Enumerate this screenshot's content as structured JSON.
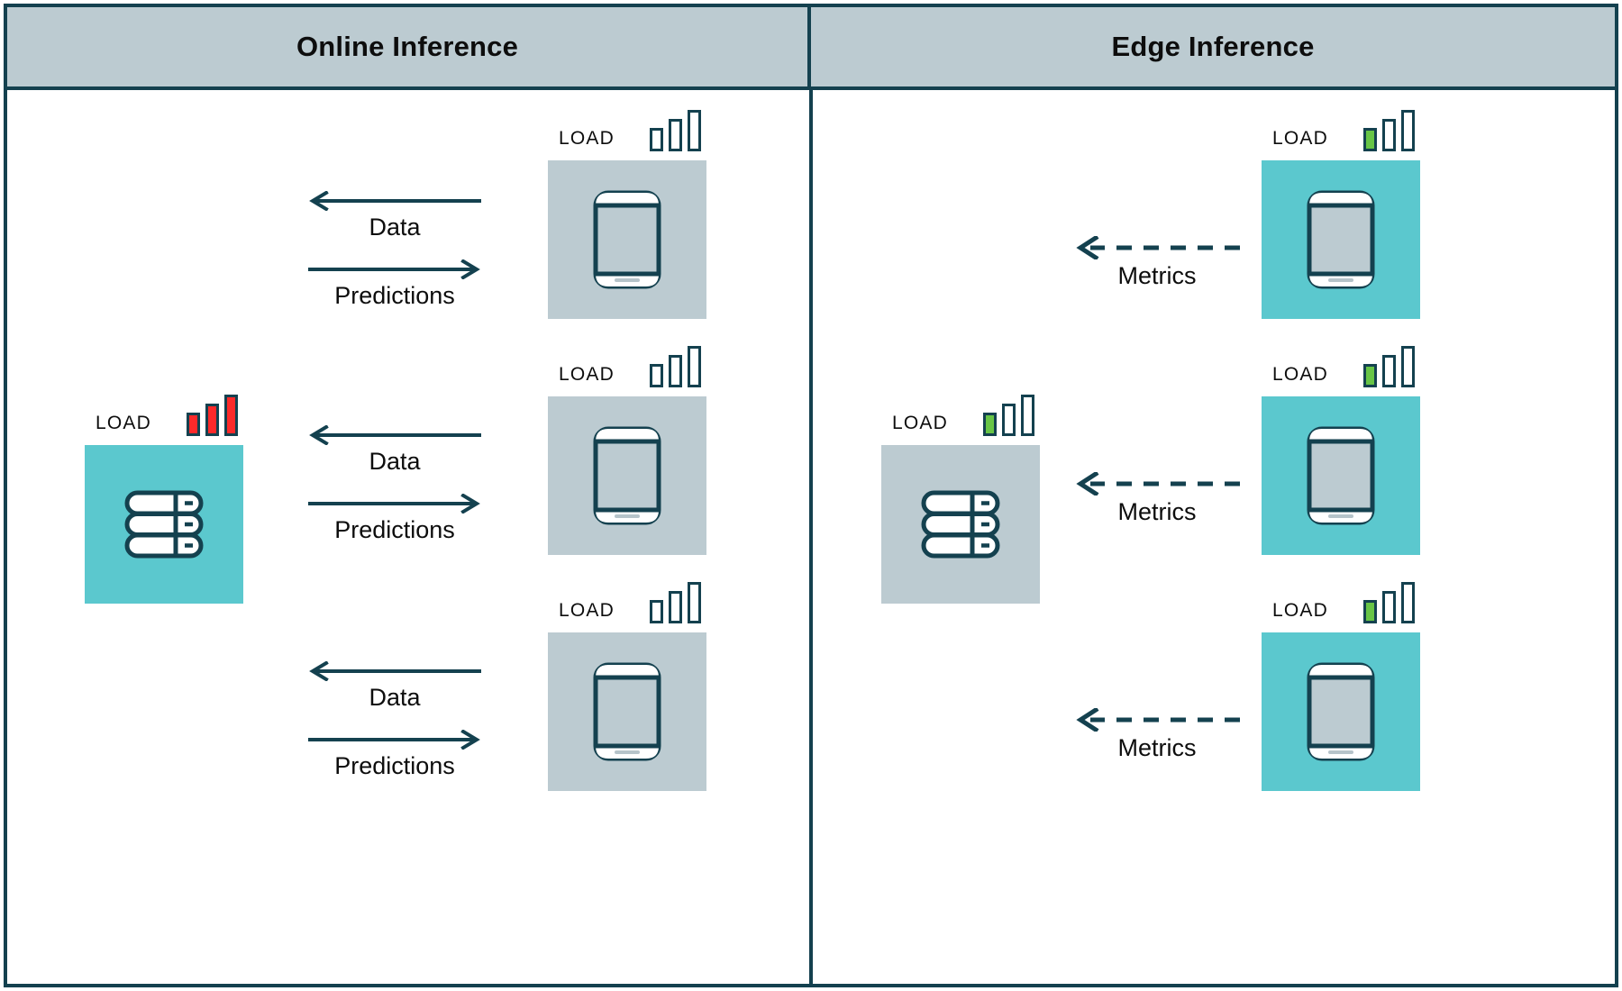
{
  "diagram": {
    "title_left": "Online Inference",
    "title_right": "Edge Inference",
    "colors": {
      "border": "#14414F",
      "header_bg": "#BCCBD1",
      "teal": "#5BC8CE",
      "gray": "#BCCBD1",
      "load_red": "#FC2A2A",
      "load_green": "#68C546",
      "stroke": "#14414F"
    }
  },
  "labels": {
    "load": "LOAD",
    "data": "Data",
    "predictions": "Predictions",
    "metrics": "Metrics"
  },
  "online": {
    "server": {
      "load_label": "LOAD",
      "load_state": "red-high",
      "box_color": "teal",
      "icon": "server-icon"
    },
    "devices": [
      {
        "load_label": "LOAD",
        "load_state": "empty",
        "box_color": "gray",
        "icon": "phone-icon"
      },
      {
        "load_label": "LOAD",
        "load_state": "empty",
        "box_color": "gray",
        "icon": "phone-icon"
      },
      {
        "load_label": "LOAD",
        "load_state": "empty",
        "box_color": "gray",
        "icon": "phone-icon"
      }
    ],
    "flows": [
      {
        "inbound": "Data",
        "outbound": "Predictions",
        "style": "solid"
      },
      {
        "inbound": "Data",
        "outbound": "Predictions",
        "style": "solid"
      },
      {
        "inbound": "Data",
        "outbound": "Predictions",
        "style": "solid"
      }
    ]
  },
  "edge": {
    "server": {
      "load_label": "LOAD",
      "load_state": "green-low",
      "box_color": "gray",
      "icon": "server-icon"
    },
    "devices": [
      {
        "load_label": "LOAD",
        "load_state": "green-low",
        "box_color": "teal",
        "icon": "phone-icon"
      },
      {
        "load_label": "LOAD",
        "load_state": "green-low",
        "box_color": "teal",
        "icon": "phone-icon"
      },
      {
        "load_label": "LOAD",
        "load_state": "green-low",
        "box_color": "teal",
        "icon": "phone-icon"
      }
    ],
    "flows": [
      {
        "inbound": "Metrics",
        "style": "dashed"
      },
      {
        "inbound": "Metrics",
        "style": "dashed"
      },
      {
        "inbound": "Metrics",
        "style": "dashed"
      }
    ]
  }
}
